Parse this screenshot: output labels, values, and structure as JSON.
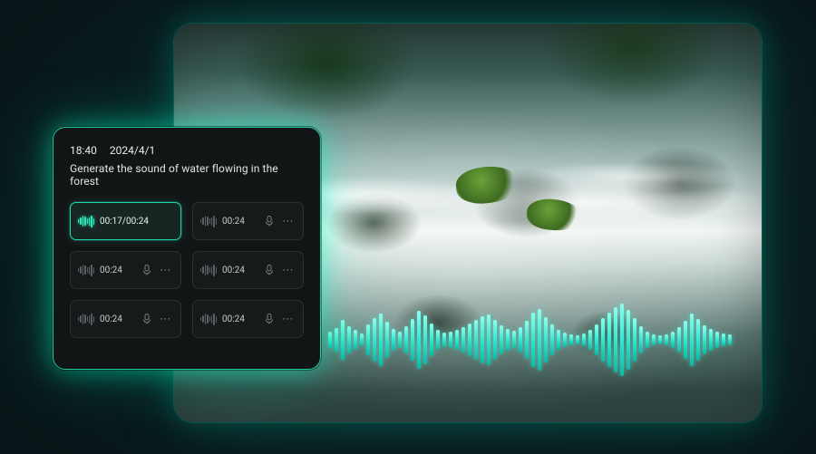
{
  "colors": {
    "accent": "#1fd4a7",
    "panel_bg": "#121516",
    "card_border": "#2b3030"
  },
  "panel": {
    "time": "18:40",
    "date": "2024/4/1",
    "prompt": "Generate the sound of water flowing in the forest"
  },
  "clips": [
    {
      "time_display": "00:17/00:24",
      "active": true,
      "show_actions": false
    },
    {
      "time_display": "00:24",
      "active": false,
      "show_actions": true
    },
    {
      "time_display": "00:24",
      "active": false,
      "show_actions": true
    },
    {
      "time_display": "00:24",
      "active": false,
      "show_actions": true
    },
    {
      "time_display": "00:24",
      "active": false,
      "show_actions": true
    },
    {
      "time_display": "00:24",
      "active": false,
      "show_actions": true
    }
  ],
  "waveform_heights": [
    18,
    26,
    44,
    30,
    22,
    14,
    34,
    48,
    58,
    40,
    24,
    18,
    30,
    46,
    64,
    54,
    36,
    22,
    16,
    18,
    22,
    28,
    36,
    44,
    52,
    56,
    44,
    32,
    24,
    20,
    28,
    42,
    60,
    68,
    50,
    34,
    22,
    16,
    12,
    10,
    14,
    22,
    34,
    48,
    60,
    72,
    80,
    66,
    48,
    30,
    18,
    12,
    10,
    12,
    18,
    28,
    42,
    58,
    46,
    32,
    24,
    18,
    14,
    12
  ],
  "mini_heights": [
    4,
    8,
    12,
    10,
    6,
    9,
    13,
    7
  ]
}
